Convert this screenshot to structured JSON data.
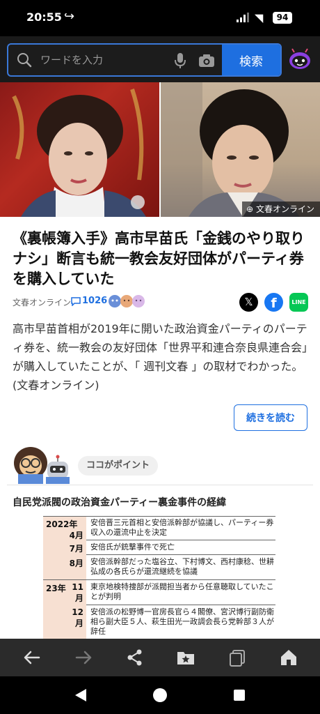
{
  "status_bar": {
    "time": "20:55",
    "battery": "94"
  },
  "search": {
    "placeholder": "ワードを入力",
    "button_label": "検索"
  },
  "hero": {
    "credit": "文春オンライン"
  },
  "article": {
    "title": "《裏帳簿入手》高市早苗氏「金銭のやり取りナシ」断言も統一教会友好団体がパーティ券を購入していた",
    "source": "文春オンライン",
    "comment_count": "1026",
    "summary": "高市早苗首相が2019年に開いた政治資金パーティのパーティ券を、統一教会の友好団体「世界平和連合奈良県連合会」が購入していたことが、「 週刊文春 」の取材でわかった。(文春オンライン)",
    "more_label": "続きを読む"
  },
  "point": {
    "label": "ココがポイント",
    "table_title": "自民党派閥の政治資金パーティー裏金事件の経緯",
    "timeline": [
      {
        "year": "2022年",
        "month": "4月",
        "text": "安倍晋三元首相と安倍派幹部が協議し、パーティー券収入の還流中止を決定"
      },
      {
        "year": "",
        "month": "7月",
        "text": "安倍氏が銃撃事件で死亡"
      },
      {
        "year": "",
        "month": "8月",
        "text": "安倍派幹部だった塩谷立、下村博文、西村康稔、世耕弘成の各氏らが還流継続を協議"
      },
      {
        "year": "23年",
        "month": "11月",
        "text": "東京地検特捜部が派閥担当者から任意聴取していたことが判明"
      },
      {
        "year": "",
        "month": "12月",
        "text": "安倍派の松野博一官房長官ら４閣僚、宮沢博行副防衛相ら副大臣５人、萩生田光一政調会長ら党幹部３人が辞任"
      }
    ]
  },
  "colors": {
    "accent": "#1e6fe0",
    "header_bg": "#1a1a1a",
    "timeline_bg": "#f7e0d2"
  }
}
